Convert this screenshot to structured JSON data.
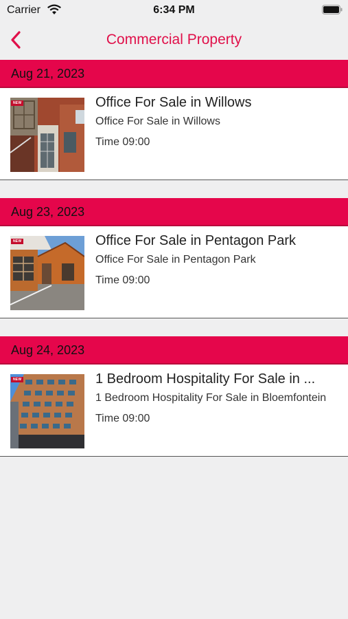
{
  "status_bar": {
    "carrier": "Carrier",
    "time": "6:34 PM"
  },
  "nav": {
    "title": "Commercial Property",
    "accent_color": "#e0104a"
  },
  "sections": [
    {
      "date": "Aug 21, 2023",
      "listing": {
        "badge": "NEW",
        "title": "Office For Sale in Willows",
        "subtitle": "Office For Sale in Willows",
        "time": "Time 09:00"
      }
    },
    {
      "date": "Aug 23, 2023",
      "listing": {
        "badge": "NEW",
        "title": "Office For Sale in Pentagon Park",
        "subtitle": "Office For Sale in Pentagon Park",
        "time": "Time 09:00"
      }
    },
    {
      "date": "Aug 24, 2023",
      "listing": {
        "badge": "NEW",
        "title": "1 Bedroom Hospitality For Sale in ...",
        "subtitle": "1 Bedroom Hospitality For Sale in Bloemfontein",
        "time": "Time 09:00"
      }
    }
  ],
  "colors": {
    "section_header": "#e5064b",
    "background": "#efeff0"
  }
}
